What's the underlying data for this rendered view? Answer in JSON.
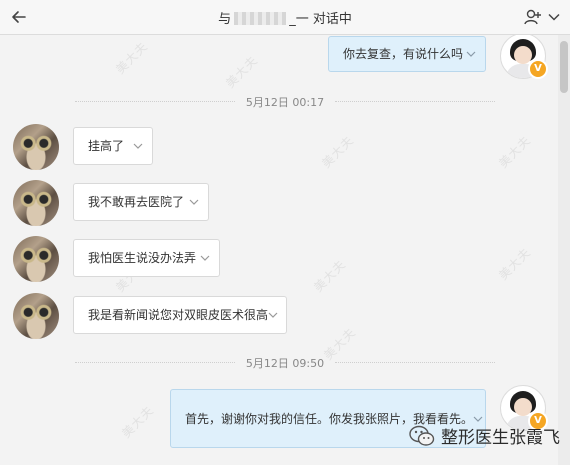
{
  "header": {
    "title_prefix": "与",
    "title_suffix": "_一 对话中"
  },
  "watermark_text": "美大夫",
  "messages": [
    {
      "text": "你去复查，有说什么吗",
      "direction": "out"
    },
    {
      "text": "挂高了",
      "direction": "in"
    },
    {
      "text": "我不敢再去医院了",
      "direction": "in"
    },
    {
      "text": "我怕医生说没办法弄",
      "direction": "in"
    },
    {
      "text": "我是看新闻说您对双眼皮医术很高",
      "direction": "in"
    },
    {
      "text": "首先，谢谢你对我的信任。你发我张照片，我看看先。",
      "direction": "out"
    }
  ],
  "timestamps": [
    "5月12日 00:17",
    "5月12日 09:50"
  ],
  "verified_badge": "V",
  "brand_label": "整形医生张霞飞",
  "colors": {
    "outgoing_bubble": "#dff0fb",
    "incoming_bubble": "#ffffff",
    "badge": "#f5a623"
  },
  "icons": [
    "back-arrow-icon",
    "add-user-icon",
    "chevron-down-icon",
    "wechat-icon"
  ]
}
